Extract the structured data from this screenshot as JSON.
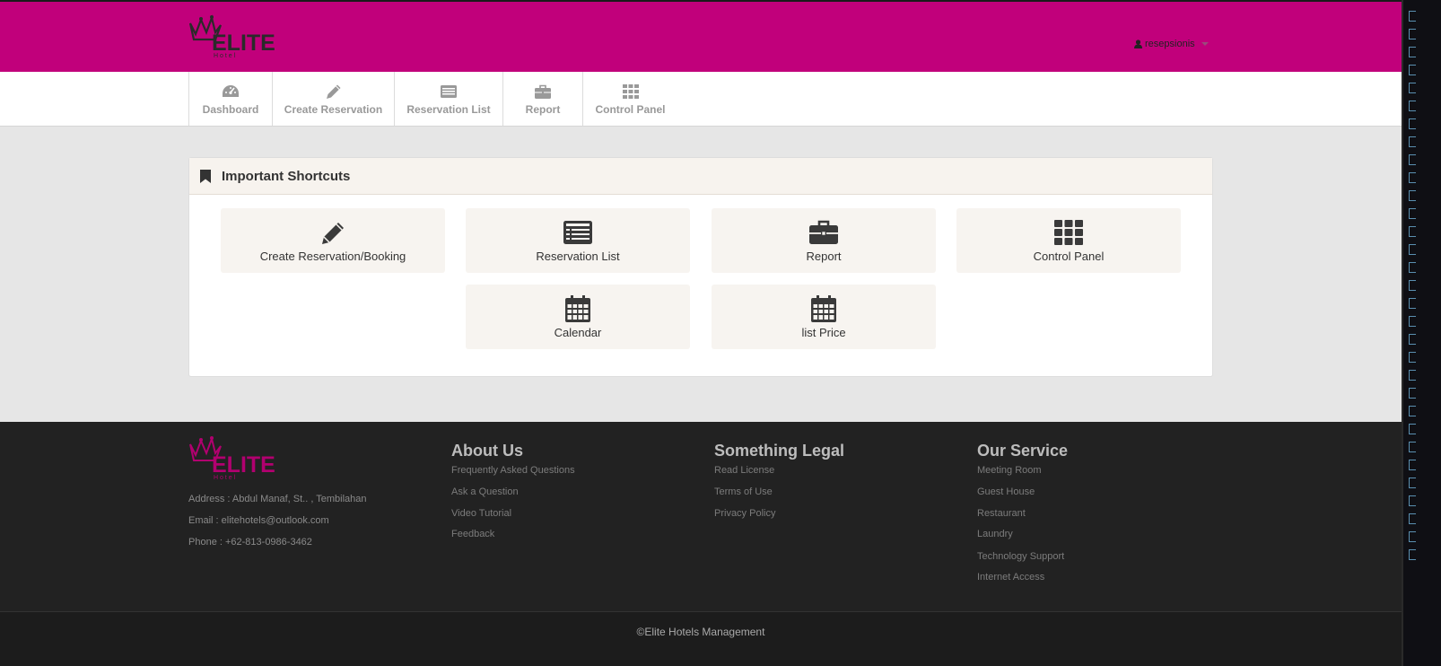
{
  "header": {
    "logo_text": "ELITE",
    "logo_subtext": "H o t e l",
    "user_name": "resepsionis",
    "brand_color": "#c1007b"
  },
  "nav": {
    "items": [
      {
        "label": "Dashboard",
        "icon": "dashboard-icon"
      },
      {
        "label": "Create Reservation",
        "icon": "pencil-icon"
      },
      {
        "label": "Reservation List",
        "icon": "list-icon"
      },
      {
        "label": "Report",
        "icon": "briefcase-icon"
      },
      {
        "label": "Control Panel",
        "icon": "grid-icon"
      }
    ]
  },
  "shortcuts": {
    "title": "Important Shortcuts",
    "items": [
      {
        "label": "Create Reservation/Booking",
        "icon": "pencil-icon"
      },
      {
        "label": "Reservation List",
        "icon": "list-icon"
      },
      {
        "label": "Report",
        "icon": "briefcase-icon"
      },
      {
        "label": "Control Panel",
        "icon": "grid-icon"
      },
      {
        "label": "Calendar",
        "icon": "calendar-icon"
      },
      {
        "label": "list Price",
        "icon": "calendar-icon"
      }
    ]
  },
  "footer": {
    "address": "Address : Abdul Manaf, St.. , Tembilahan",
    "email": "Email : elitehotels@outlook.com",
    "phone": "Phone : +62-813-0986-3462",
    "columns": [
      {
        "title": "About Us",
        "links": [
          "Frequently Asked Questions",
          "Ask a Question",
          "Video Tutorial",
          "Feedback"
        ]
      },
      {
        "title": "Something Legal",
        "links": [
          "Read License",
          "Terms of Use",
          "Privacy Policy"
        ]
      },
      {
        "title": "Our Service",
        "links": [
          "Meeting Room",
          "Guest House",
          "Restaurant",
          "Laundry",
          "Technology Support",
          "Internet Access"
        ]
      }
    ],
    "copyright": "©Elite Hotels Management"
  }
}
